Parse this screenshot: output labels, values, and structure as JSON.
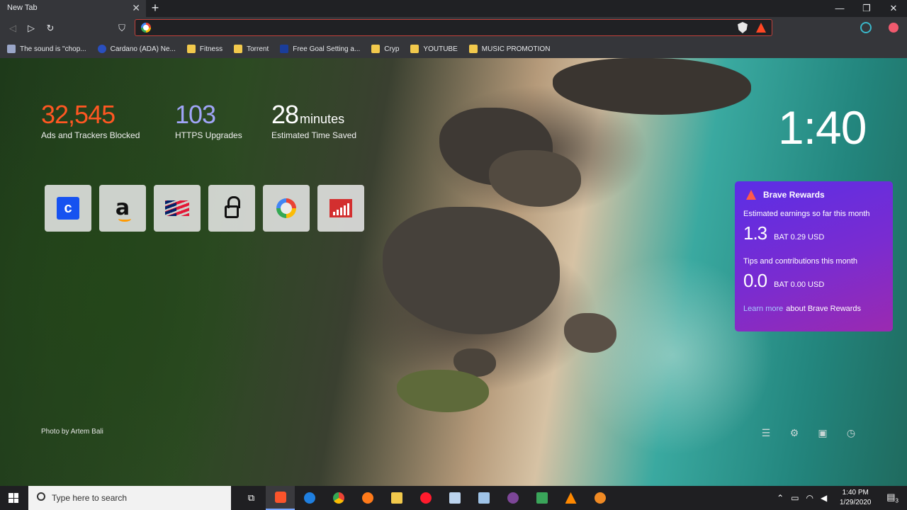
{
  "browser": {
    "tab_title": "New Tab",
    "tab_close": "✕",
    "new_tab": "+",
    "window_controls": [
      "—",
      "❐",
      "✕"
    ],
    "address_value": "",
    "back_icon": "back-icon",
    "forward_icon": "forward-icon",
    "reload_icon": "reload-icon",
    "bookmark_icon": "bookmark-icon"
  },
  "bookmarks": [
    {
      "label": "The sound is \"chop...",
      "icon": "page-icon"
    },
    {
      "label": "Cardano (ADA) Ne...",
      "icon": "cardano-icon"
    },
    {
      "label": "Fitness",
      "icon": "folder-icon"
    },
    {
      "label": "Torrent",
      "icon": "folder-icon"
    },
    {
      "label": "Free Goal Setting a...",
      "icon": "page-icon"
    },
    {
      "label": "Cryp",
      "icon": "folder-icon"
    },
    {
      "label": "YOUTUBE",
      "icon": "folder-icon"
    },
    {
      "label": "MUSIC PROMOTION",
      "icon": "folder-icon"
    }
  ],
  "stats": {
    "ads_value": "32,545",
    "ads_label": "Ads and Trackers Blocked",
    "ads_color": "#ff5722",
    "https_value": "103",
    "https_label": "HTTPS Upgrades",
    "https_color": "#a0a5f7",
    "time_value": "28",
    "time_unit": "minutes",
    "time_label": "Estimated Time Saved"
  },
  "clock": "1:40",
  "top_sites": [
    {
      "name": "coinbase"
    },
    {
      "name": "amazon",
      "glyph": "a"
    },
    {
      "name": "bank-of-america"
    },
    {
      "name": "lock"
    },
    {
      "name": "google"
    },
    {
      "name": "stats-bars"
    }
  ],
  "rewards": {
    "title": "Brave Rewards",
    "earnings_label": "Estimated earnings so far this month",
    "earnings_bat": "1.3",
    "earnings_fiat": "BAT 0.29 USD",
    "tips_label": "Tips and contributions this month",
    "tips_bat": "0.0",
    "tips_fiat": "BAT 0.00 USD",
    "learn_more": "Learn more",
    "learn_more_suffix": "about Brave Rewards"
  },
  "photo_credit": "Photo by Artem Bali",
  "taskbar": {
    "search_placeholder": "Type here to search",
    "time": "1:40 PM",
    "date": "1/29/2020",
    "notifications_count": "3"
  }
}
